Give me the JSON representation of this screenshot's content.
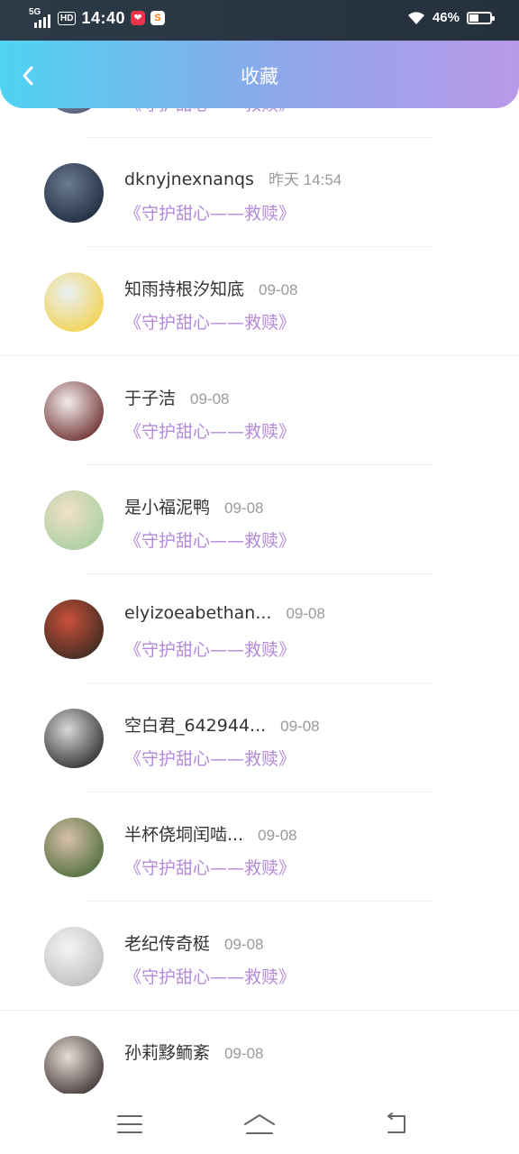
{
  "status_bar": {
    "network": "5G",
    "hd_label": "HD",
    "time": "14:40",
    "battery_percent": "46%",
    "battery_level": 0.46,
    "app_icon_2_letter": "S"
  },
  "header": {
    "title": "收藏",
    "gradient_start": "#4fd2f2",
    "gradient_end": "#b999e9",
    "back_icon": "chevron-left-icon"
  },
  "favorites": [
    {
      "name": "",
      "date": "",
      "book": "《守护甜心——救赎》",
      "avatar_palette": [
        "#4a5470",
        "#c8cdd8"
      ]
    },
    {
      "name": "dknyjnexnanqs",
      "date": "昨天 14:54",
      "book": "《守护甜心——救赎》",
      "avatar_palette": [
        "#1d2a3c",
        "#6a7a90"
      ]
    },
    {
      "name": "知雨持根汐知底",
      "date": "09-08",
      "book": "《守护甜心——救赎》",
      "avatar_palette": [
        "#f4d24a",
        "#e8f0f5"
      ]
    },
    {
      "name": "于子洁",
      "date": "09-08",
      "book": "《守护甜心——救赎》",
      "avatar_palette": [
        "#6a2a2a",
        "#f3eded"
      ]
    },
    {
      "name": "是小福泥鸭",
      "date": "09-08",
      "book": "《守护甜心——救赎》",
      "avatar_palette": [
        "#a7cfa0",
        "#f0e0c8"
      ]
    },
    {
      "name": "elyizoeabethan...",
      "date": "09-08",
      "book": "《守护甜心——救赎》",
      "avatar_palette": [
        "#3a2a22",
        "#c8503a"
      ]
    },
    {
      "name": "空白君_642944...",
      "date": "09-08",
      "book": "《守护甜心——救赎》",
      "avatar_palette": [
        "#2a2a2a",
        "#d8d8d8"
      ]
    },
    {
      "name": "半杯侥垌闰啮...",
      "date": "09-08",
      "book": "《守护甜心——救赎》",
      "avatar_palette": [
        "#4a6a3a",
        "#d8c0a8"
      ]
    },
    {
      "name": "老纪传奇梃",
      "date": "09-08",
      "book": "《守护甜心——救赎》",
      "avatar_palette": [
        "#bdbdbd",
        "#f5f5f5"
      ]
    },
    {
      "name": "孙莉黟鲕紊",
      "date": "09-08",
      "book": "",
      "avatar_palette": [
        "#3a3030",
        "#e8ddd5"
      ]
    }
  ],
  "nav_bar": {
    "menu_icon": "menu-icon",
    "home_icon": "home-icon",
    "back_icon": "back-icon"
  }
}
